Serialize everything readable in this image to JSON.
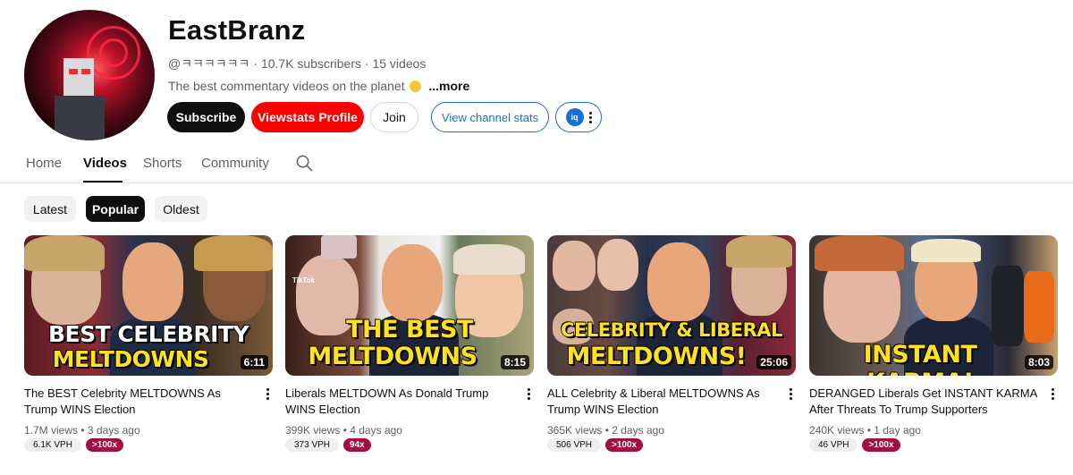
{
  "channel": {
    "name": "EastBranz",
    "handle": "@ㅋㅋㅋㅋㅋㅋ",
    "subscribers": "10.7K subscribers",
    "video_count": "15 videos",
    "description": "The best commentary videos on the planet",
    "more_label": "...more",
    "avatar_icon": "channel-avatar"
  },
  "actions": {
    "subscribe": "Subscribe",
    "viewstats": "Viewstats Profile",
    "join": "Join",
    "channel_stats": "View channel stats",
    "extension_icon": "iq"
  },
  "tabs": [
    {
      "label": "Home"
    },
    {
      "label": "Videos"
    },
    {
      "label": "Shorts"
    },
    {
      "label": "Community"
    }
  ],
  "active_tab": "Videos",
  "chips": [
    {
      "label": "Latest"
    },
    {
      "label": "Popular"
    },
    {
      "label": "Oldest"
    }
  ],
  "active_chip": "Popular",
  "videos": [
    {
      "title": "The BEST Celebrity MELTDOWNS As Trump WINS Election",
      "views": "1.7M views",
      "age": "3 days ago",
      "duration": "6:11",
      "vph": "6.1K VPH",
      "outlier": ">100x",
      "thumb_line1": "BEST CELEBRITY",
      "thumb_line2": "MELTDOWNS",
      "thumb_tag": ""
    },
    {
      "title": "Liberals MELTDOWN As Donald Trump WINS Election",
      "views": "399K views",
      "age": "4 days ago",
      "duration": "8:15",
      "vph": "373 VPH",
      "outlier": "94x",
      "thumb_line1": "THE BEST",
      "thumb_line2": "MELTDOWNS",
      "thumb_tag": "TikTok"
    },
    {
      "title": "ALL Celebrity & Liberal MELTDOWNS As Trump WINS Election",
      "views": "365K views",
      "age": "2 days ago",
      "duration": "25:06",
      "vph": "506 VPH",
      "outlier": ">100x",
      "thumb_line1": "CELEBRITY & LIBERAL",
      "thumb_line2": "MELTDOWNS!",
      "thumb_tag": ""
    },
    {
      "title": "DERANGED Liberals Get INSTANT KARMA After Threats To Trump Supporters",
      "views": "240K views",
      "age": "1 day ago",
      "duration": "8:03",
      "vph": "46 VPH",
      "outlier": ">100x",
      "thumb_line1": "",
      "thumb_line2": "INSTANT KARMA!",
      "thumb_tag": ""
    }
  ],
  "colors": {
    "subscribe_bg": "#0f0f0f",
    "viewstats_bg": "#ff0000",
    "stats_accent": "#1a6ed8",
    "outlier_badge": "#a10d45",
    "caption_yellow": "#ffe21f"
  }
}
